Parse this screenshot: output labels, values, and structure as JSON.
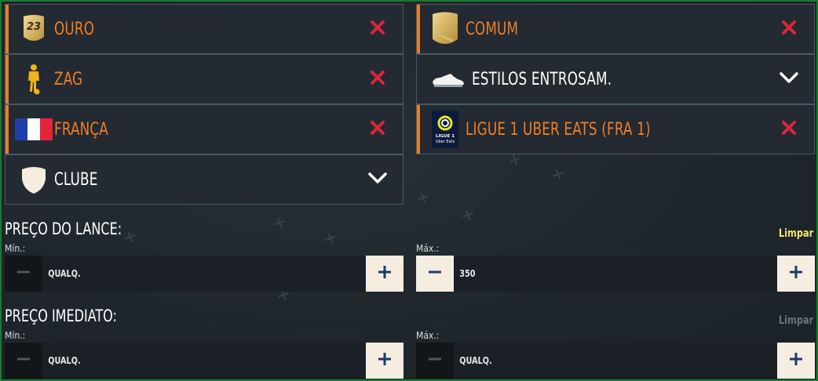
{
  "filters": {
    "quality": {
      "label": "OURO",
      "badge_number": "23",
      "active": true
    },
    "rarity": {
      "label": "COMUM",
      "active": true
    },
    "position": {
      "label": "ZAG",
      "active": true
    },
    "chemistry": {
      "label": "ESTILOS ENTROSAM.",
      "active": false
    },
    "nation": {
      "label": "FRANÇA",
      "active": true
    },
    "league": {
      "label": "LIGUE 1 UBER EATS (FRA 1)",
      "logo_text_1": "LIGUE 1",
      "logo_text_2": "Uber Eats",
      "active": true
    },
    "club": {
      "label": "CLUBE",
      "active": false
    }
  },
  "bid_price": {
    "title": "PREÇO DO LANCE:",
    "clear_label": "Limpar",
    "min_label": "Mín.:",
    "min_value": "QUALQ.",
    "max_label": "Máx.:",
    "max_value": "350"
  },
  "buy_now_price": {
    "title": "PREÇO IMEDIATO:",
    "clear_label": "Limpar",
    "min_label": "Mín.:",
    "min_value": "QUALQ.",
    "max_label": "Máx.:",
    "max_value": "QUALQ."
  },
  "colors": {
    "accent_orange": "#f07e28",
    "remove_red": "#d9263a",
    "clear_active": "#f5e36a",
    "clear_disabled": "#6b747a"
  }
}
